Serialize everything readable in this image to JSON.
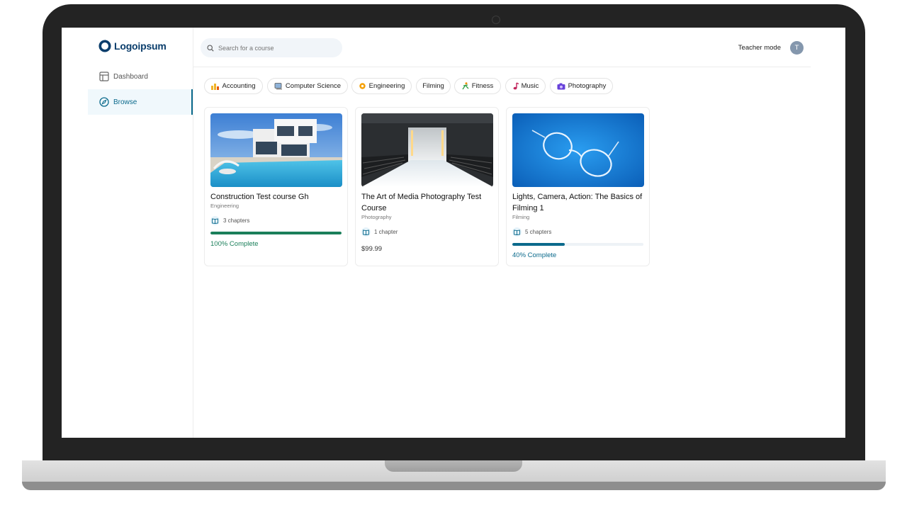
{
  "brand": {
    "name": "Logoipsum"
  },
  "sidebar": {
    "items": [
      {
        "label": "Dashboard",
        "icon": "layout-icon",
        "active": false
      },
      {
        "label": "Browse",
        "icon": "compass-icon",
        "active": true
      }
    ]
  },
  "header": {
    "search_placeholder": "Search for a course",
    "mode_label": "Teacher mode",
    "avatar_initial": "T"
  },
  "categories": [
    {
      "label": "Accounting",
      "icon": "📊"
    },
    {
      "label": "Computer Science",
      "icon": "💻"
    },
    {
      "label": "Engineering",
      "icon": "⚙️"
    },
    {
      "label": "Filming",
      "icon": ""
    },
    {
      "label": "Fitness",
      "icon": "🤸"
    },
    {
      "label": "Music",
      "icon": "🎵"
    },
    {
      "label": "Photography",
      "icon": "📷"
    }
  ],
  "courses": [
    {
      "title": "Construction Test course Gh",
      "category": "Engineering",
      "chapters": "3 chapters",
      "progress": 100,
      "progress_label": "100% Complete",
      "progress_color": "#1a7f5a"
    },
    {
      "title": "The Art of Media Photography Test Course",
      "category": "Photography",
      "chapters": "1 chapter",
      "price": "$99.99"
    },
    {
      "title": "Lights, Camera, Action: The Basics of Filming 1",
      "category": "Filming",
      "chapters": "5 chapters",
      "progress": 40,
      "progress_label": "40% Complete",
      "progress_color": "#0b6a8c"
    }
  ]
}
